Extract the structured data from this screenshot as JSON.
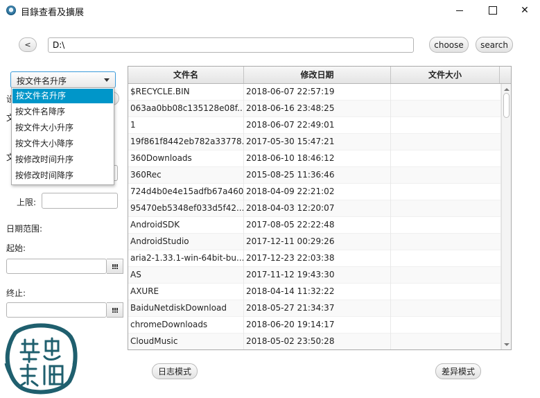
{
  "window": {
    "title": "目錄查看及擴展",
    "close_glyph": "✕"
  },
  "toolbar": {
    "back_label": "<",
    "path_value": "D:\\",
    "choose_label": "choose",
    "search_label": "search"
  },
  "sort": {
    "selected": "按文件名升序",
    "options": [
      "按文件名升序",
      "按文件名降序",
      "按文件大小升序",
      "按文件大小降序",
      "按修改时间升序",
      "按修改时间降序"
    ]
  },
  "left_panel": {
    "partial_char_1": "设",
    "partial_char_2": "文",
    "partial_char_3": "文",
    "upper_label": "上限:",
    "date_range_label": "日期范围:",
    "start_label": "起始:",
    "end_label": "终止:"
  },
  "table": {
    "columns": [
      "文件名",
      "修改日期",
      "文件大小"
    ],
    "rows": [
      {
        "name": "$RECYCLE.BIN",
        "date": "2018-06-07 22:57:19",
        "size": ""
      },
      {
        "name": "063aa0bb08c135128e08f...",
        "date": "2018-06-16 23:48:25",
        "size": ""
      },
      {
        "name": "1",
        "date": "2018-06-07 22:49:01",
        "size": ""
      },
      {
        "name": "19f861f8442eb782a33778...",
        "date": "2017-05-30 15:47:21",
        "size": ""
      },
      {
        "name": "360Downloads",
        "date": "2018-06-10 18:46:12",
        "size": ""
      },
      {
        "name": "360Rec",
        "date": "2015-08-25 11:36:46",
        "size": ""
      },
      {
        "name": "724d4b0e4e15adfb67a460",
        "date": "2018-04-09 22:21:02",
        "size": ""
      },
      {
        "name": "95470eb5348ef033d5f42...",
        "date": "2018-04-03 12:20:07",
        "size": ""
      },
      {
        "name": "AndroidSDK",
        "date": "2017-08-05 22:22:48",
        "size": ""
      },
      {
        "name": "AndroidStudio",
        "date": "2017-12-11 00:29:26",
        "size": ""
      },
      {
        "name": "aria2-1.33.1-win-64bit-bu...",
        "date": "2017-12-23 22:03:38",
        "size": ""
      },
      {
        "name": "AS",
        "date": "2017-11-12 19:43:30",
        "size": ""
      },
      {
        "name": "AXURE",
        "date": "2018-04-14 11:32:22",
        "size": ""
      },
      {
        "name": "BaiduNetdiskDownload",
        "date": "2018-05-27 21:34:37",
        "size": ""
      },
      {
        "name": "chromeDownloads",
        "date": "2018-06-20 19:14:17",
        "size": ""
      },
      {
        "name": "CloudMusic",
        "date": "2018-05-02 23:50:28",
        "size": ""
      }
    ]
  },
  "bottom": {
    "log_mode_label": "日志模式",
    "diff_mode_label": "差异模式"
  },
  "colors": {
    "selection": "#0096c9",
    "focus_border": "#3a9ad9",
    "seal_color": "#1f5f6e"
  },
  "logo": {
    "seal_text": "篆忠哉恒"
  }
}
